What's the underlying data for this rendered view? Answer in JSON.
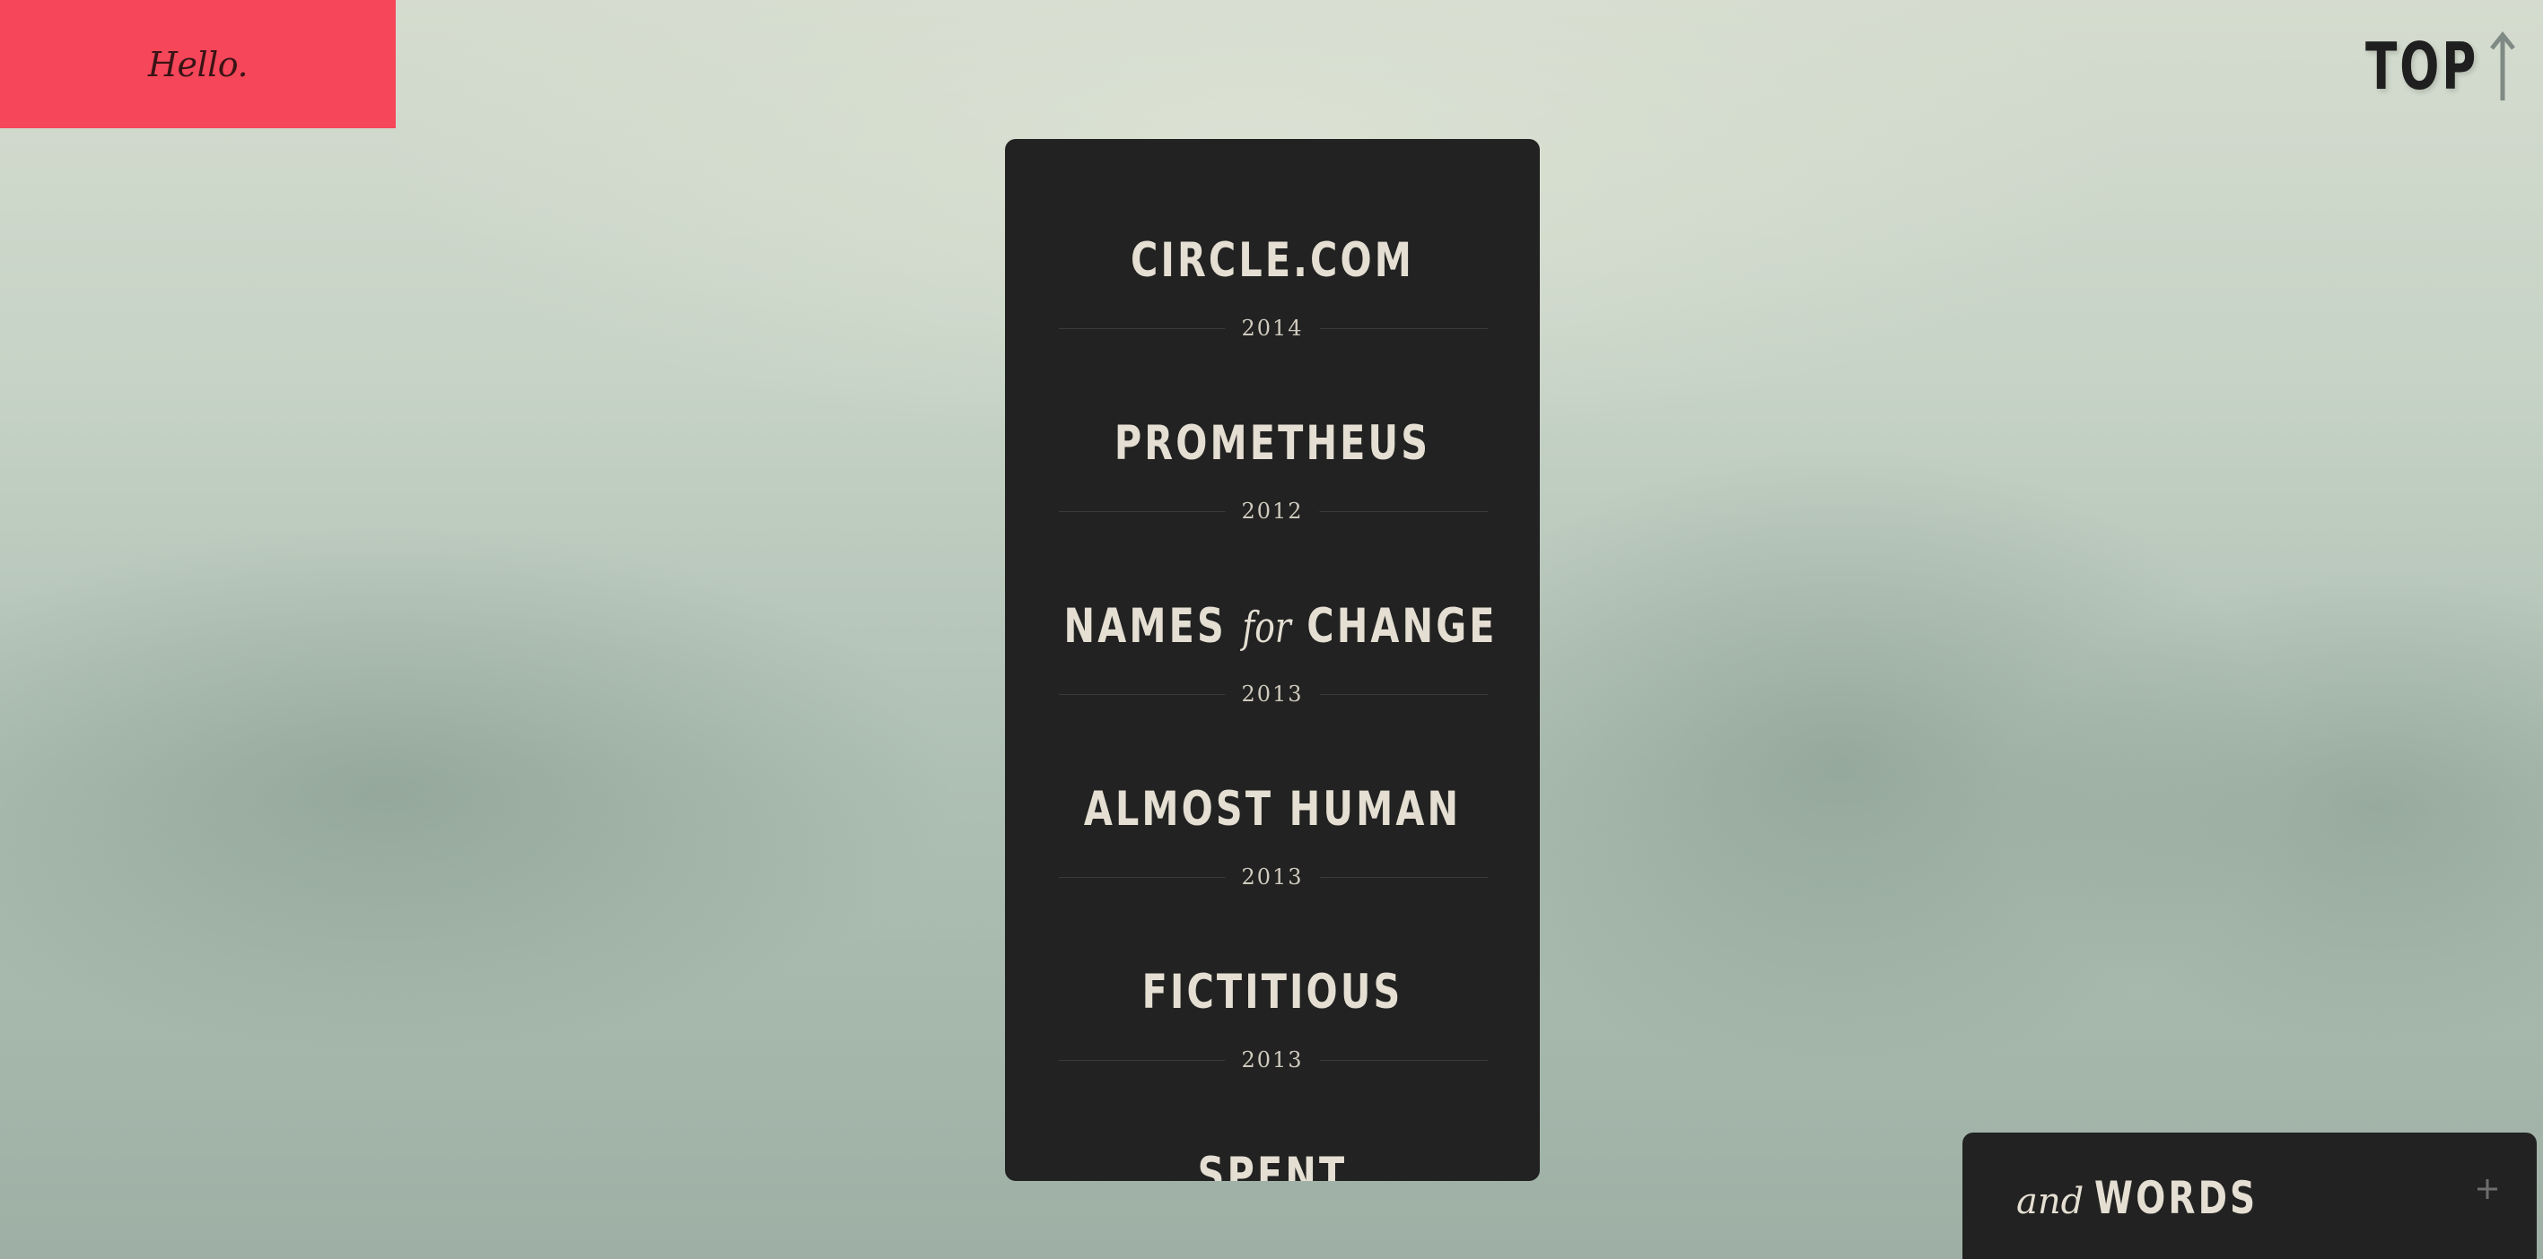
{
  "colors": {
    "accent": "#f64659",
    "panel": "#222222",
    "panel_text": "#e4dfd2"
  },
  "header": {
    "greeting": "Hello.",
    "top_label": "TOP",
    "top_icon": "arrow-up-icon"
  },
  "projects": [
    {
      "title": "CIRCLE.COM",
      "year": "2014"
    },
    {
      "title": "PROMETHEUS",
      "year": "2012"
    },
    {
      "title_pre": "NAMES",
      "title_mid": "for",
      "title_post": "CHANGE",
      "year": "2013"
    },
    {
      "title": "ALMOST HUMAN",
      "year": "2013"
    },
    {
      "title": "FICTITIOUS",
      "year": "2013"
    },
    {
      "title": "SPENT",
      "year": ""
    }
  ],
  "footer_panel": {
    "and": "and",
    "words": "WORDS",
    "expand_icon": "plus-icon"
  }
}
